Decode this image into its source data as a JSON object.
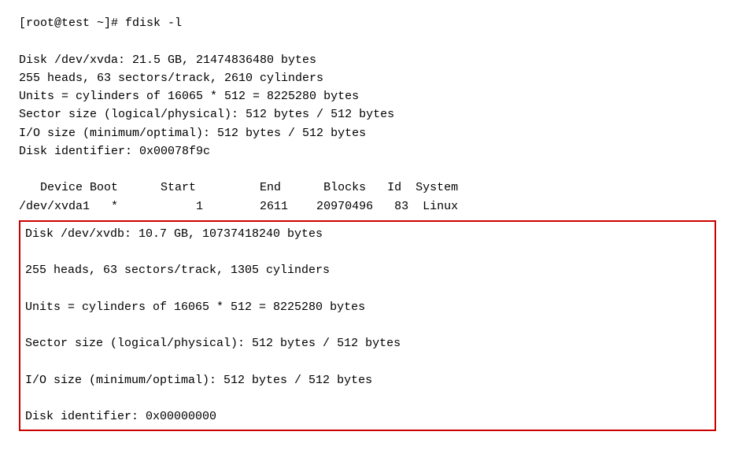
{
  "terminal": {
    "prompt": "[root@test ~]# fdisk -l",
    "disk1": {
      "header": "Disk /dev/xvda: 21.5 GB, 21474836480 bytes",
      "heads": "255 heads, 63 sectors/track, 2610 cylinders",
      "units": "Units = cylinders of 16065 * 512 = 8225280 bytes",
      "sector_size": "Sector size (logical/physical): 512 bytes / 512 bytes",
      "io_size": "I/O size (minimum/optimal): 512 bytes / 512 bytes",
      "identifier": "Disk identifier: 0x00078f9c"
    },
    "partition_table": {
      "header": "   Device Boot      Start         End      Blocks   Id  System",
      "row1": "/dev/xvda1   *           1        2611    20970496   83  Linux"
    },
    "disk2": {
      "header": "Disk /dev/xvdb: 10.7 GB, 10737418240 bytes",
      "heads": "255 heads, 63 sectors/track, 1305 cylinders",
      "units": "Units = cylinders of 16065 * 512 = 8225280 bytes",
      "sector_size": "Sector size (logical/physical): 512 bytes / 512 bytes",
      "io_size": "I/O size (minimum/optimal): 512 bytes / 512 bytes",
      "identifier": "Disk identifier: 0x00000000"
    }
  }
}
